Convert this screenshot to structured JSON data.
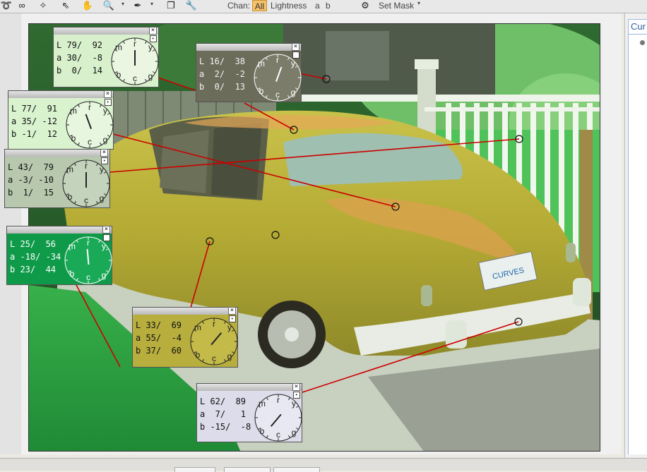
{
  "toolbar": {
    "chan_label": "Chan:",
    "chan_all": "All",
    "chan_lightness": "Lightness",
    "chan_a": "a",
    "chan_b": "b",
    "set_mask": "Set Mask"
  },
  "panel": {
    "tab_label": "Cur"
  },
  "probes": [
    {
      "id": "probe-1",
      "L": "79/  92",
      "a": "30/  -8",
      "b": " 0/  14",
      "bg": "#d8f0cc",
      "text": "#111111",
      "clock": "#eaf6e2",
      "hand": "#222222",
      "angle": 90
    },
    {
      "id": "probe-2",
      "L": "16/  38",
      "a": " 2/  -2",
      "b": " 0/  13",
      "bg": "#6b6c5a",
      "text": "#f2f2f2",
      "clock": "#7b7c6a",
      "hand": "#ffffff",
      "angle": 70
    },
    {
      "id": "probe-3",
      "L": "77/  91",
      "a": "35/ -12",
      "b": "-1/  12",
      "bg": "#d9f3cf",
      "text": "#111111",
      "clock": "#e7f7df",
      "hand": "#222222",
      "angle": 110
    },
    {
      "id": "probe-4",
      "L": "43/  79",
      "a": "-3/ -10",
      "b": " 1/  15",
      "bg": "#b7c8ae",
      "text": "#111111",
      "clock": "#c4d3bb",
      "hand": "#222222",
      "angle": 90
    },
    {
      "id": "probe-5",
      "L": "25/  56",
      "a": "-18/ -34",
      "b": "23/  44",
      "bg": "#0f9a4a",
      "text": "#ffffff",
      "clock": "#1aa957",
      "hand": "#ffffff",
      "angle": 95
    },
    {
      "id": "probe-6",
      "L": "33/  69",
      "a": "55/  -4",
      "b": "37/  60",
      "bg": "#b7ae3e",
      "text": "#111111",
      "clock": "#c3ba4a",
      "hand": "#222222",
      "angle": 50
    },
    {
      "id": "probe-7",
      "L": "62/  89",
      "a": " 7/   1",
      "b": "-15/  -8",
      "bg": "#dcdcea",
      "text": "#111111",
      "clock": "#e8e8f2",
      "hand": "#222222",
      "angle": 230
    }
  ],
  "icons": {
    "eyedropper": "eyedropper-icon",
    "hand": "hand-icon",
    "zoom": "zoom-icon",
    "copy": "copy-icon",
    "wrench": "wrench-icon",
    "mask": "mask-icon"
  },
  "colors": {
    "leader": "#cc0000",
    "accent": "#f5c26b"
  }
}
